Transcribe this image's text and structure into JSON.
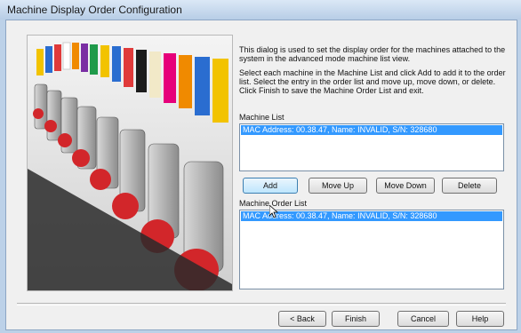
{
  "window": {
    "title": "Machine Display Order Configuration"
  },
  "description": {
    "para1": "This dialog is used to set the display order for the machines attached to the system in the advanced mode machine list view.",
    "para2": "Select each machine in the Machine List and click Add to add it to the order list. Select the entry in the order list and move up, move down, or delete. Click Finish to save the Machine Order List and exit."
  },
  "machine_list": {
    "label": "Machine List",
    "items": [
      "MAC Address: 00.38.47, Name: INVALID, S/N: 328680"
    ]
  },
  "list_buttons": {
    "add": "Add",
    "move_up": "Move Up",
    "move_down": "Move Down",
    "delete": "Delete"
  },
  "order_list": {
    "label": "Machine Order List",
    "items": [
      "MAC Address: 00.38.47, Name: INVALID, S/N: 328680"
    ]
  },
  "nav_buttons": {
    "back": "< Back",
    "finish": "Finish",
    "cancel": "Cancel",
    "help": "Help"
  },
  "colors": {
    "selection": "#3399ff",
    "thread_red": "#d2262a"
  },
  "icons": {
    "cursor": "mouse-pointer-icon"
  }
}
